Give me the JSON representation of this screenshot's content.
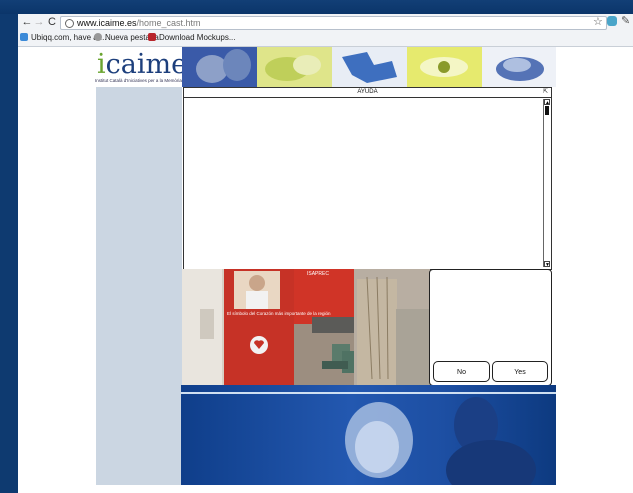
{
  "browser": {
    "url_domain": "www.icaime.es",
    "url_path": "/home_cast.htm",
    "bookmarks": [
      {
        "label": "Ubiqq.com, have a ...",
        "icon": "ubiqq-icon"
      },
      {
        "label": "Nueva pestaña",
        "icon": "globe-icon"
      },
      {
        "label": "Download Mockups...",
        "icon": "balsamiq-icon"
      }
    ]
  },
  "site": {
    "logo_text": "icaime",
    "logo_subtitle": "Institut Català d'Iniciatives per a la Memòria"
  },
  "help_panel": {
    "title": "AYUDA"
  },
  "dialog": {
    "no_label": "No",
    "yes_label": "Yes"
  },
  "photo": {
    "sign_text": "ISAPREC",
    "banner_text": "El símbolo del Corazón más importante de la región"
  },
  "colors": {
    "desktop": "#0e3a70",
    "sidebar": "#cbd6e2",
    "brand_blue": "#1d3f7c",
    "brand_green": "#6aa42f"
  }
}
